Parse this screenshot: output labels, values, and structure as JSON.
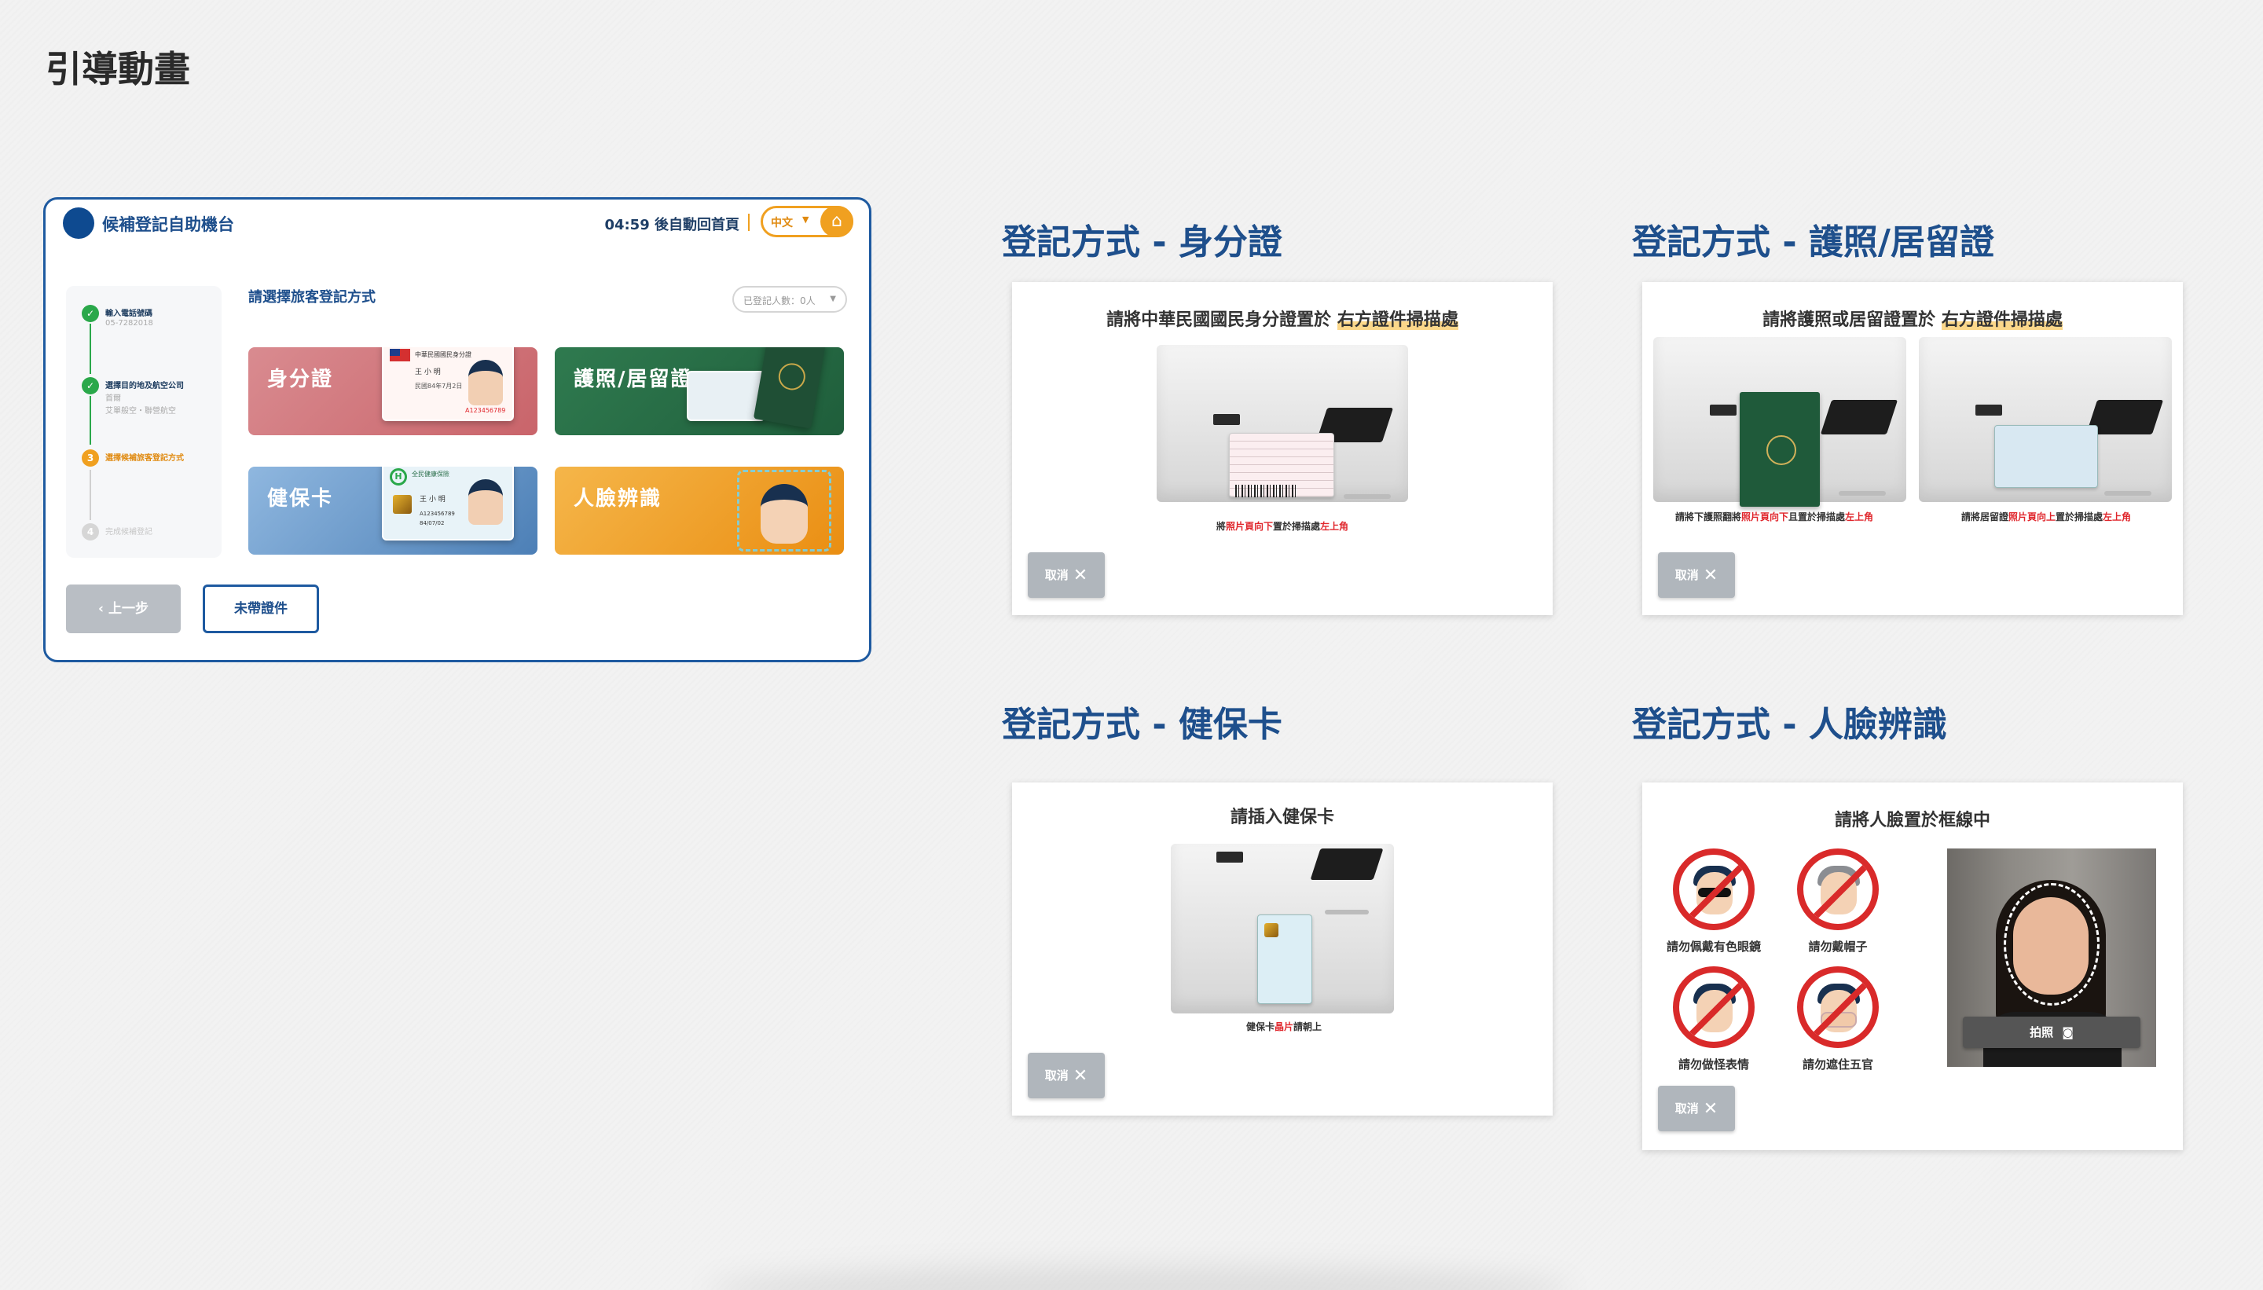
{
  "page": {
    "title": "引導動畫"
  },
  "kiosk": {
    "title": "候補登記自助機台",
    "timer": "04:59 後自動回首頁",
    "lang": "中文",
    "home_icon": "home-icon",
    "steps": [
      {
        "label": "輸入電話號碼",
        "sub": "05-7282018",
        "state": "done"
      },
      {
        "label": "選擇目的地及航空公司",
        "sub": "首爾",
        "sub2": "艾單般空・聯營航空",
        "state": "done"
      },
      {
        "label": "選擇候補旅客登記方式",
        "state": "active"
      },
      {
        "label": "完成候補登記",
        "state": "todo"
      }
    ],
    "prompt": "請選擇旅客登記方式",
    "count_label": "已登記人數：0人",
    "methods": [
      {
        "label": "身分證"
      },
      {
        "label": "護照/居留證"
      },
      {
        "label": "健保卡"
      },
      {
        "label": "人臉辨識"
      }
    ],
    "id_card": {
      "header": "中華民國國民身分證",
      "name": "王 小 明",
      "birth": "民國84年7月2日",
      "number": "A123456789"
    },
    "nhi_card": {
      "header": "全民健康保險",
      "name": "王 小 明",
      "number": "A123456789",
      "birth": "84/07/02"
    },
    "back_label": "上一步",
    "nodoc_label": "未帶證件"
  },
  "sections": {
    "id": {
      "title": "登記方式 - 身分證",
      "heading_pre": "請將中華民國國民身分證置於",
      "heading_hl": "右方證件掃描處",
      "caption_pre": "將",
      "caption_red1": "照片頁向下",
      "caption_mid": "置於掃描處",
      "caption_red2": "左上角",
      "cancel": "取消"
    },
    "passport": {
      "title": "登記方式 - 護照/居留證",
      "heading_pre": "請將護照或居留證置於",
      "heading_hl": "右方證件掃描處",
      "caption1_pre": "請將下護照翻將",
      "caption1_red1": "照片頁向下",
      "caption1_mid": "且置於掃描處",
      "caption1_red2": "左上角",
      "caption2_pre": "請將居留證",
      "caption2_red1": "照片頁向上",
      "caption2_mid": "置於掃描處",
      "caption2_red2": "左上角",
      "cancel": "取消"
    },
    "nhi": {
      "title": "登記方式 - 健保卡",
      "heading": "請插入健保卡",
      "caption_pre": "健保卡",
      "caption_red": "晶片",
      "caption_post": "請朝上",
      "cancel": "取消"
    },
    "face": {
      "title": "登記方式 - 人臉辨識",
      "heading": "請將人臉置於框線中",
      "rules": [
        {
          "label": "請勿佩戴有色眼鏡",
          "icon": "no-sunglasses-icon"
        },
        {
          "label": "請勿戴帽子",
          "icon": "no-hat-icon"
        },
        {
          "label": "請勿做怪表情",
          "icon": "no-funny-face-icon"
        },
        {
          "label": "請勿遮住五官",
          "icon": "no-cover-face-icon"
        }
      ],
      "shoot_label": "拍照",
      "cancel": "取消"
    }
  },
  "colors": {
    "brand": "#1e4f8c",
    "accent": "#f0a020",
    "danger": "#d92a2a",
    "success": "#2aa84a"
  }
}
